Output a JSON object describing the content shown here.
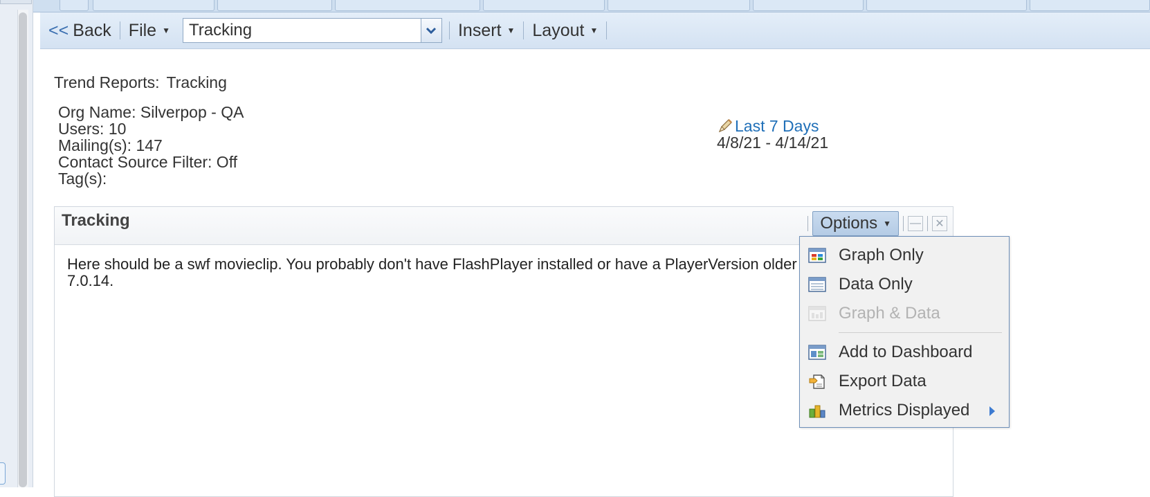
{
  "toolbar": {
    "back_label": "Back",
    "back_arrows": "<<",
    "file_label": "File",
    "report_select_value": "Tracking",
    "insert_label": "Insert",
    "layout_label": "Layout"
  },
  "report": {
    "title_prefix": "Trend Reports:",
    "title_name": "Tracking",
    "org_name": "Org Name: Silverpop - QA",
    "users": "Users: 10",
    "mailings": "Mailing(s): 147",
    "contact_source_filter": "Contact Source Filter: Off",
    "tags": "Tag(s):",
    "date_link": "Last 7 Days",
    "date_range": "4/8/21 - 4/14/21"
  },
  "panel": {
    "title": "Tracking",
    "options_label": "Options",
    "body_line1": "Here should be a swf movieclip. You probably don't have FlashPlayer installed or have a PlayerVersion older than",
    "body_line2": "7.0.14."
  },
  "options_menu": {
    "items": [
      {
        "label": "Graph Only",
        "icon": "graph-icon",
        "enabled": true
      },
      {
        "label": "Data Only",
        "icon": "data-table-icon",
        "enabled": true
      },
      {
        "label": "Graph & Data",
        "icon": "graph-data-icon",
        "enabled": false
      },
      {
        "label": "Add to Dashboard",
        "icon": "dashboard-icon",
        "enabled": true
      },
      {
        "label": "Export Data",
        "icon": "export-icon",
        "enabled": true
      },
      {
        "label": "Metrics Displayed",
        "icon": "metrics-icon",
        "enabled": true,
        "submenu": true
      }
    ]
  },
  "colors": {
    "accent": "#1f6fb8",
    "toolbar_bg": "#d4e2f2",
    "menu_border": "#6e8fb8"
  }
}
